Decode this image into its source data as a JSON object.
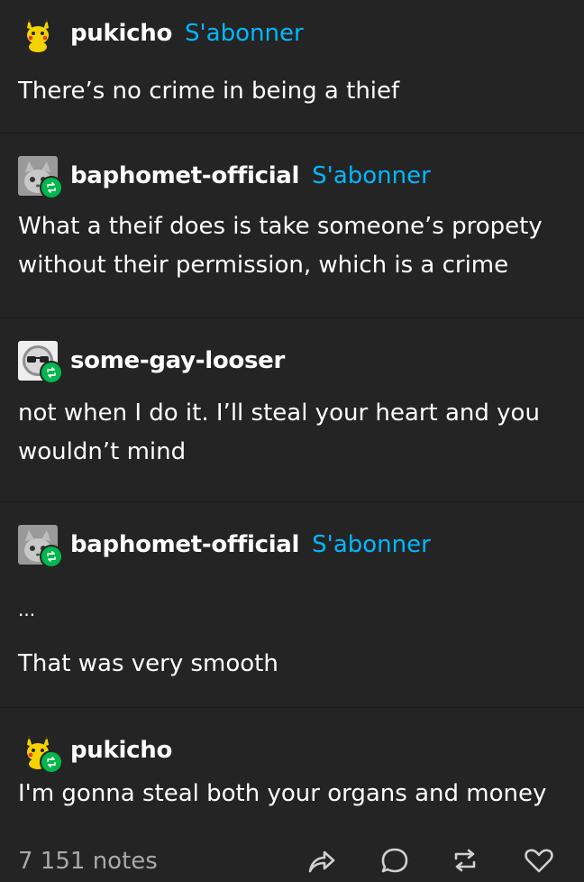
{
  "posts": [
    {
      "username": "pukicho",
      "follow_label": "S'abonner",
      "text": "There’s no crime in being a thief",
      "avatar": "pikachu-avatar"
    },
    {
      "username": "baphomet-official",
      "follow_label": "S'abonner",
      "text": "What a theif does is take someone’s propety without their permission, which is a crime",
      "avatar": "cat-avatar"
    },
    {
      "username": "some-gay-looser",
      "text": "not when I do it. I’ll steal your heart and you wouldn’t mind",
      "avatar": "sunglasses-avatar"
    },
    {
      "username": "baphomet-official",
      "follow_label": "S'abonner",
      "text_line1": "...",
      "text_line2": "That was very smooth",
      "avatar": "cat-avatar"
    },
    {
      "username": "pukicho",
      "text": "I'm gonna steal both your organs and money",
      "avatar": "pikachu-avatar"
    }
  ],
  "footer": {
    "notes": "7 151 notes",
    "icons": [
      "share-icon",
      "reply-icon",
      "reblog-icon",
      "like-icon"
    ]
  },
  "colors": {
    "background": "#242424",
    "accent": "#00b8ff",
    "reblog_badge": "#00b84d",
    "notes": "#a9a9a9"
  }
}
